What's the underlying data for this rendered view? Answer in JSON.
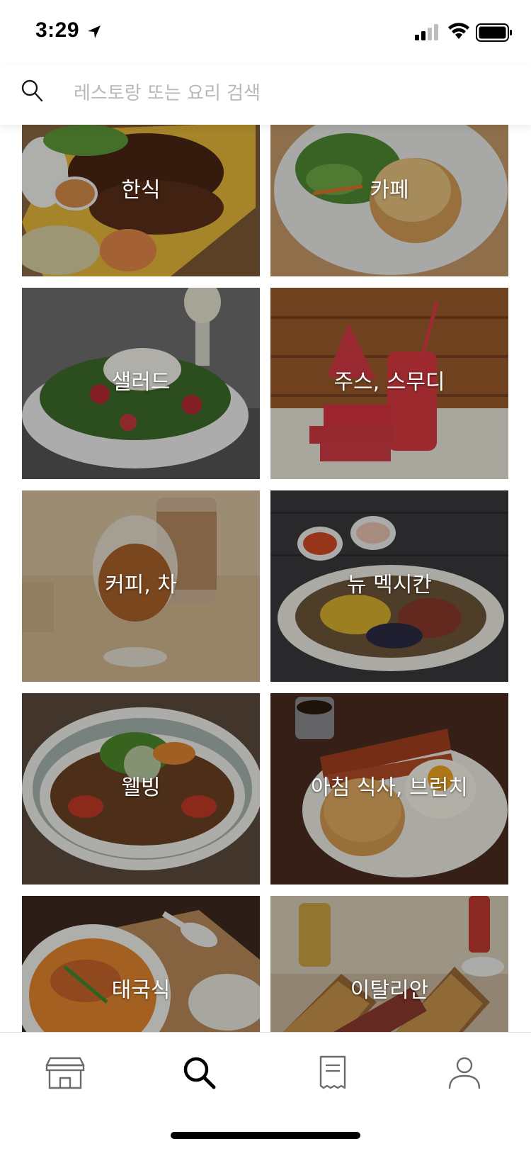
{
  "status_bar": {
    "time": "3:29",
    "icons": [
      "location-arrow-icon",
      "signal-icon",
      "wifi-icon",
      "battery-icon"
    ]
  },
  "search": {
    "placeholder": "레스토랑 또는 요리 검색",
    "value": "",
    "icon": "search-icon"
  },
  "categories": [
    {
      "label": "한식",
      "icon": "korean-food-photo"
    },
    {
      "label": "카페",
      "icon": "cafe-photo"
    },
    {
      "label": "샐러드",
      "icon": "salad-photo"
    },
    {
      "label": "주스, 스무디",
      "icon": "juice-photo"
    },
    {
      "label": "커피, 차",
      "icon": "coffee-photo"
    },
    {
      "label": "뉴 멕시칸",
      "icon": "mexican-photo"
    },
    {
      "label": "웰빙",
      "icon": "wellbeing-photo"
    },
    {
      "label": "아침 식사, 브런치",
      "icon": "brunch-photo"
    },
    {
      "label": "태국식",
      "icon": "thai-photo"
    },
    {
      "label": "이탈리안",
      "icon": "italian-photo"
    }
  ],
  "tab_bar": {
    "tabs": [
      {
        "name": "home",
        "icon": "storefront-icon",
        "active": false
      },
      {
        "name": "search",
        "icon": "search-icon",
        "active": true
      },
      {
        "name": "orders",
        "icon": "receipt-icon",
        "active": false
      },
      {
        "name": "account",
        "icon": "person-icon",
        "active": false
      }
    ]
  },
  "colors": {
    "background": "#ffffff",
    "placeholder": "#b8b8b8",
    "tile_label": "#ffffff",
    "tab_inactive": "#6b6b6b",
    "tab_active": "#000000"
  }
}
